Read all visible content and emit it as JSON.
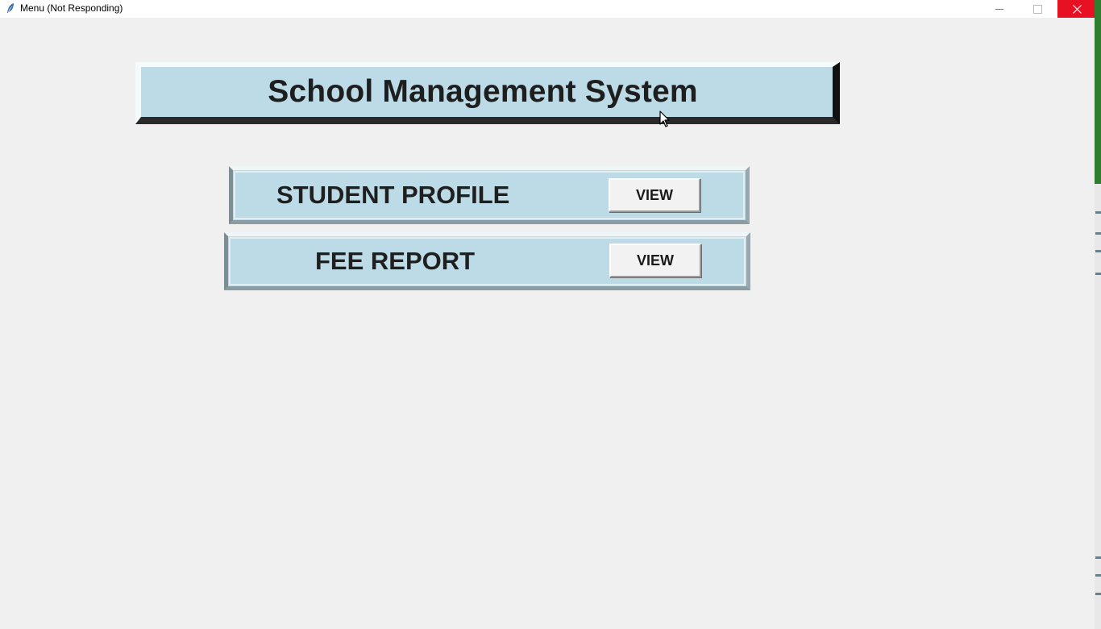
{
  "window": {
    "title": "Menu (Not Responding)",
    "icon": "feather-icon",
    "controls": {
      "minimize": "minimize-icon",
      "maximize": "maximize-icon",
      "close": "close-icon"
    },
    "close_color": "#e81123"
  },
  "header": {
    "title": "School Management System",
    "background": "#bcdbe6"
  },
  "menu": {
    "items": [
      {
        "label": "STUDENT PROFILE",
        "button_label": "VIEW"
      },
      {
        "label": "FEE REPORT",
        "button_label": "VIEW"
      }
    ]
  },
  "colors": {
    "window_bg": "#f0f0f0",
    "panel_bg": "#bcdbe6",
    "button_bg": "#f2f2f2"
  }
}
